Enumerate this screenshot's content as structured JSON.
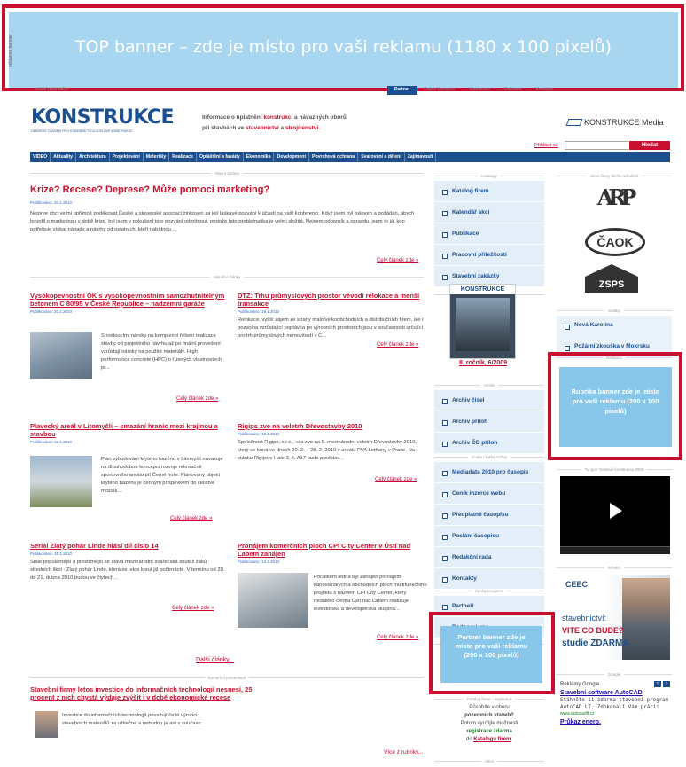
{
  "top_banner": {
    "side_label": "reklamní banner",
    "text": "TOP banner – zde je místo pro vaši reklamu (1180 x 100 pixelů)"
  },
  "topbar": {
    "issn": "ISSN 1803-8433",
    "links": [
      "Partner",
      "Odběr časopisu",
      "Mediadata",
      "Reklama",
      "Kontakty"
    ]
  },
  "logo": {
    "name": "KONSTRUKCE",
    "subtitle": "ODBORNÝ ČASOPIS PRO STAVEBNICTVÍ A OCELOVÉ KONSTRUKCE"
  },
  "tagline": {
    "line1_a": "Informace o uplatnění ",
    "line1_b": "konstrukcí",
    "line1_c": " a návazných oborů",
    "line2_a": "při stavbách ve ",
    "line2_b": "stavebnictví",
    "line2_c": " a ",
    "line2_d": "strojírenství",
    "line2_e": "."
  },
  "media": {
    "label": "KONSTRUKCE Media"
  },
  "login": {
    "link": "Přihlásit se",
    "search_button": "Hledat"
  },
  "nav": [
    "VIDEO",
    "Aktuality",
    "Architektura",
    "Projektování",
    "Materiály",
    "Realizace",
    "Opláštění a fasády",
    "Ekonomika",
    "Development",
    "Povrchová ochrana",
    "Svařování a dělení",
    "Zajímavosti"
  ],
  "main_news": {
    "section": "Hlavní zpráva",
    "title": "Krize? Recese? Deprese? Může pomoci marketing?",
    "published": "Publikováno: 20.1.2010",
    "text": "Nejprve chci velmi upřímně poděkovat České a slovenské asociaci zinkoven za její laskavé pozvání k účasti na vaší konferenci. Když jsem byl osloven a požádán, abych hovořil o marketingu v době krize, byl jsem v pokušení toto pozvání odmítnout, protože tato problematika je velmi složitá. Nejsem odborník a opravdu, jsem to já, kdo potřebuje získat nápady a návrhy od ostatních, kteří nabídnou ...",
    "more": "Celý článek zde »"
  },
  "articles_section": "Aktuální články",
  "articles": [
    {
      "title": "Vysokopevnostní OK s vysokopevnostním samozhutnitelným betonem C 80/95 v České Republice – nadzemní garáže",
      "published": "Publikováno: 20.1.2010",
      "text": "S rostoucími nároky na komplexní řešení realizace stavby od projektního návrhu až po finální provedení vzrůstají nároky na použité materiály. High performance concrete (HPC) o řízených vlastnostech pr...",
      "more": "Celý článek zde »"
    },
    {
      "title": "DTZ: Trhu průmyslových prostor vévodí relokace a menší transakce",
      "published": "Publikováno: 19.1.2010",
      "text": "Relokace, vyšší zájem ze strany malo/velkoobchodních a distribučních firem, ale i pozvolna vzrůstající poptávka po výrobních prostorech jsou v současnosti určující pro trh průmyslových nemovitostí v Č...",
      "more": "Celý článek zde »"
    },
    {
      "title": "Plavecký areál v Litomyšli – smazání hranic mezi krajinou a stavbou",
      "published": "Publikováno: 18.1.2010",
      "text": "Plán vybudování krytého bazénu v Litomyšli navazuje na dlouhodobou koncepci rozvoje rekreačně sportovního areálu při Černé hoře. Plánovaný objekt krytého bazénu je cenným příspěvkem do celistvé mozaik...",
      "more": "Celý článek zde »"
    },
    {
      "title": "Rigips zve na veletrh Dřevostavby 2010",
      "published": "Publikováno: 15.1.2010",
      "text": "Společnost Rigips, s.r.o., vás zve na 5. mezinárodní veletrh Dřevostavby 2010, který se koná ve dnech 20. 2. – 28. 2. 2010 v areálu PVA Letňany v Praze. Na stánku Rigips v Hale 3, č. A17 bude představ...",
      "more": "Celý článek zde »"
    },
    {
      "title": "Seriál Zlatý pohár Linde hlásí díl číslo 14",
      "published": "Publikováno: 15.1.2010",
      "text": "Stále populárnější a prestižnější se stává mezinárodní svářečská soutěž žáků středních škol - Zlatý pohár Linde, která se letos koná již počtrnácté. V termínu od 20. do 21. dubna 2010 budou ve čtyřech...",
      "more": "Celý článek zde »"
    },
    {
      "title": "Pronájem komerčních ploch CPI City Center v Ústí nad Labem zahájen",
      "published": "Publikováno: 14.1.2010",
      "text": "Počátkem ledna byl zahájen pronájem kancelářských a obchodních ploch multifunkčního projektu s názvem CPI City Center, který nedaleko centra Ústí nad Labem realizuje investorská a developerská skupina...",
      "more": "Celý článek zde »"
    }
  ],
  "more_articles": "Další články...",
  "commercial": {
    "section": "Komerční prezentace",
    "title": "Stavební firmy letos investice do informačních technologií nesnesí, 25 procent z nich chystá výdaje zvýšit i v dcbě ekonomické recese",
    "text": "Investice do informačních technologií považují čeští výrobci stavebních materiálů za užitečné a nebudou je ani v současn...",
    "more": "Více z rubriky..."
  },
  "catalogs": {
    "section": "Katalogy",
    "items": [
      "Katalog firem",
      "Kalendář akcí",
      "Publikace",
      "Pracovní příležitosti",
      "Stavební zakázky"
    ]
  },
  "magazine": {
    "section": "Aktuální číslo časopisu",
    "cover_title": "KONSTRUKCE",
    "caption": "8. ročník, 6/2009"
  },
  "archive": {
    "section": "Archiv",
    "items": [
      "Archiv čísel",
      "Archiv příloh",
      "Archiv ČB příloh"
    ]
  },
  "about": {
    "section": "O nás / Naše služby",
    "items": [
      "Mediadata 2010 pro časopis",
      "Ceník inzerce webu",
      "Předplatné časopisu",
      "Poslání časopisu",
      "Redakční rada",
      "Kontakty"
    ]
  },
  "support": {
    "section": "Spolupracujeme",
    "items": [
      "Partneři",
      "Podporujeme"
    ]
  },
  "partner": {
    "section": "Partner",
    "text": "Partner banner zde je místo pro vaši reklamu (200 x 100 pixelů)"
  },
  "catalog_reg": {
    "section": "Katalog firem - registrace",
    "line1": "Působíte v oboru",
    "line2": "pozemních staveb?",
    "line3": "Potom využijte možnosti",
    "line4": "registrace zdarma",
    "line5": "do ",
    "line6": "Katalogu firem",
    "line7": "."
  },
  "akce": {
    "section": "Akce"
  },
  "associations": {
    "section": "Jsme členy těchto sdružení",
    "items": [
      "ARP",
      "ČAOK",
      "ZSPS"
    ]
  },
  "events": {
    "section": "Svátky",
    "items": [
      "Nová Karolina",
      "Požární zkouška v Mokrsku"
    ]
  },
  "rubrika": {
    "section": "Reklama",
    "text": "Rubrika banner zde je místo pro vaši reklamu (200 x 100 pixelů)"
  },
  "video": {
    "section": "Tv spot Ocelové konstrukce 2009"
  },
  "kpmg": {
    "section": "KPMG",
    "brand": "CEEC",
    "line1": "stavebnictví:",
    "line2": "VITE CO BUDE?",
    "line3": "studie ZDARMA"
  },
  "google": {
    "section": "Google",
    "label": "Reklamy Google",
    "ad1_title": "Stavební software AutoCAD",
    "ad1_text": "Stáhněte si zdarma stavební program AutoCAD LT. Zdokonalí Vám práci!",
    "ad1_url": "www.autocadlt.cz",
    "ad2_title": "Průkaz energ."
  },
  "colors": {
    "accent_red": "#c8102e",
    "nav_blue": "#1b4f8f",
    "banner_blue": "#88c7ea"
  }
}
